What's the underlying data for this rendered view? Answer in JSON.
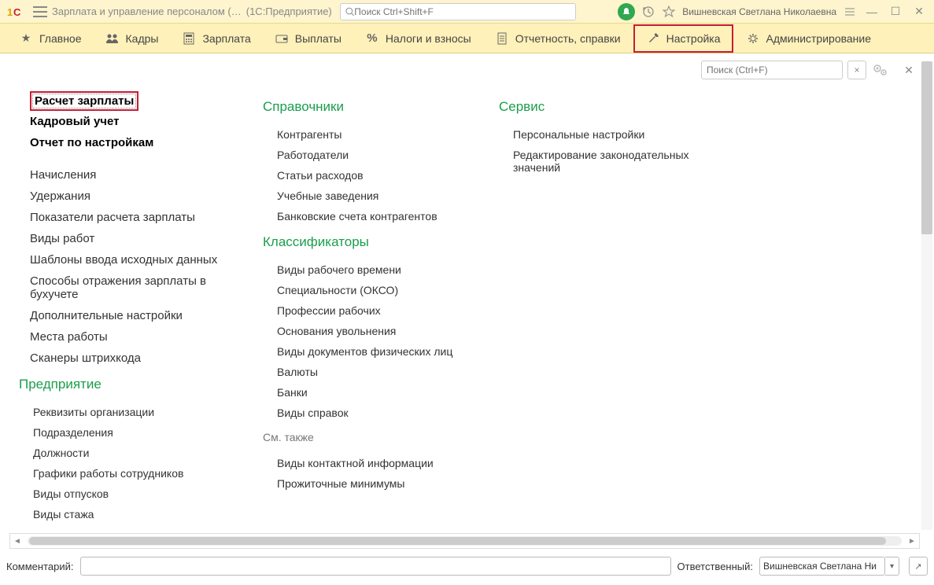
{
  "titlebar": {
    "app_title": "Зарплата и управление персоналом (…",
    "app_suffix": "(1С:Предприятие)",
    "search_placeholder": "Поиск Ctrl+Shift+F",
    "username": "Вишневская Светлана Николаевна"
  },
  "toolbar": {
    "items": [
      {
        "label": "Главное"
      },
      {
        "label": "Кадры"
      },
      {
        "label": "Зарплата"
      },
      {
        "label": "Выплаты"
      },
      {
        "label": "Налоги и взносы"
      },
      {
        "label": "Отчетность, справки"
      },
      {
        "label": "Настройка"
      },
      {
        "label": "Администрирование"
      }
    ]
  },
  "panel": {
    "search_placeholder": "Поиск (Ctrl+F)"
  },
  "col1": {
    "top": [
      "Расчет зарплаты",
      "Кадровый учет",
      "Отчет по настройкам"
    ],
    "group1": [
      "Начисления",
      "Удержания",
      "Показатели расчета зарплаты",
      "Виды работ",
      "Шаблоны ввода исходных данных",
      "Способы отражения зарплаты в бухучете",
      "Дополнительные настройки",
      "Места работы",
      "Сканеры штрихкода"
    ],
    "section2_title": "Предприятие",
    "group2": [
      "Реквизиты организации",
      "Подразделения",
      "Должности",
      "Графики работы сотрудников",
      "Виды отпусков",
      "Виды стажа"
    ]
  },
  "col2": {
    "section1_title": "Справочники",
    "group1": [
      "Контрагенты",
      "Работодатели",
      "Статьи расходов",
      "Учебные заведения",
      "Банковские счета контрагентов"
    ],
    "section2_title": "Классификаторы",
    "group2": [
      "Виды рабочего времени",
      "Специальности (ОКСО)",
      "Профессии рабочих",
      "Основания увольнения",
      "Виды документов физических лиц",
      "Валюты",
      "Банки",
      "Виды справок"
    ],
    "section3_title": "См. также",
    "group3": [
      "Виды контактной информации",
      "Прожиточные минимумы"
    ]
  },
  "col3": {
    "section1_title": "Сервис",
    "group1": [
      "Персональные настройки",
      "Редактирование законодательных значений"
    ]
  },
  "footer": {
    "comment_label": "Комментарий:",
    "responsible_label": "Ответственный:",
    "responsible_value": "Вишневская Светлана Ни"
  }
}
